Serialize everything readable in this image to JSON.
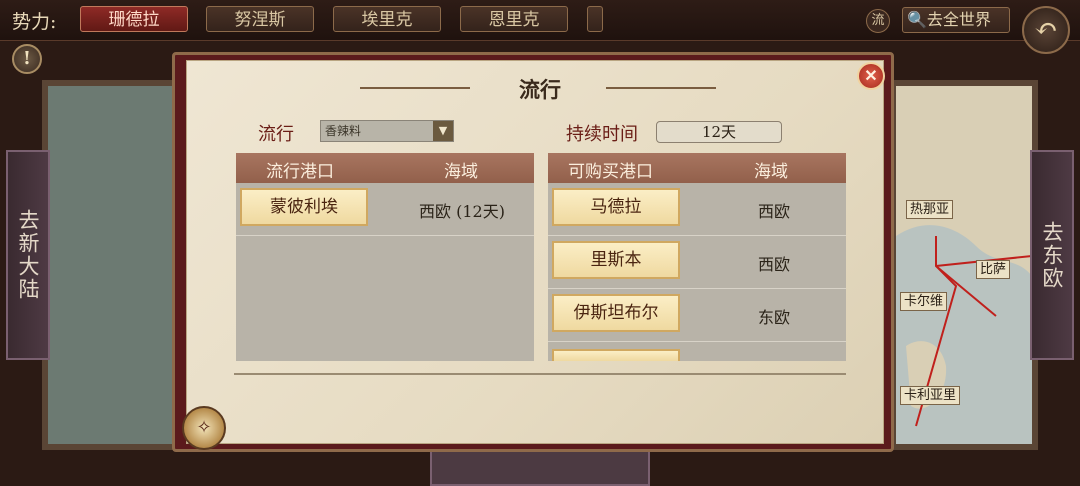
{
  "topbar": {
    "faction_label": "势力:",
    "tabs": [
      {
        "label": "珊德拉",
        "active": true
      },
      {
        "label": "努涅斯",
        "active": false
      },
      {
        "label": "埃里克",
        "active": false
      },
      {
        "label": "恩里克",
        "active": false
      }
    ],
    "flow_button": "流",
    "world_button": "🔍去全世界",
    "back_icon": "↶"
  },
  "alert_icon": "!",
  "side_buttons": {
    "left": "去新大陆",
    "right": "去东欧"
  },
  "map_cities": [
    "热那亚",
    "比萨",
    "卡尔维",
    "卡利亚里"
  ],
  "dialog": {
    "title": "流行",
    "close_icon": "✕",
    "trend_label": "流行",
    "trend_value": "香辣料",
    "duration_label": "持续时间",
    "duration_value": "12天",
    "left_table": {
      "headers": [
        "流行港口",
        "海域"
      ],
      "rows": [
        {
          "port": "蒙彼利埃",
          "sea": "西欧 (12天)"
        }
      ]
    },
    "right_table": {
      "headers": [
        "可购买港口",
        "海域"
      ],
      "rows": [
        {
          "port": "马德拉",
          "sea": "西欧"
        },
        {
          "port": "里斯本",
          "sea": "西欧"
        },
        {
          "port": "伊斯坦布尔",
          "sea": "东欧"
        }
      ]
    }
  },
  "colors": {
    "accent": "#8e2a26",
    "paper": "#efe6d3",
    "header": "#a87560"
  }
}
